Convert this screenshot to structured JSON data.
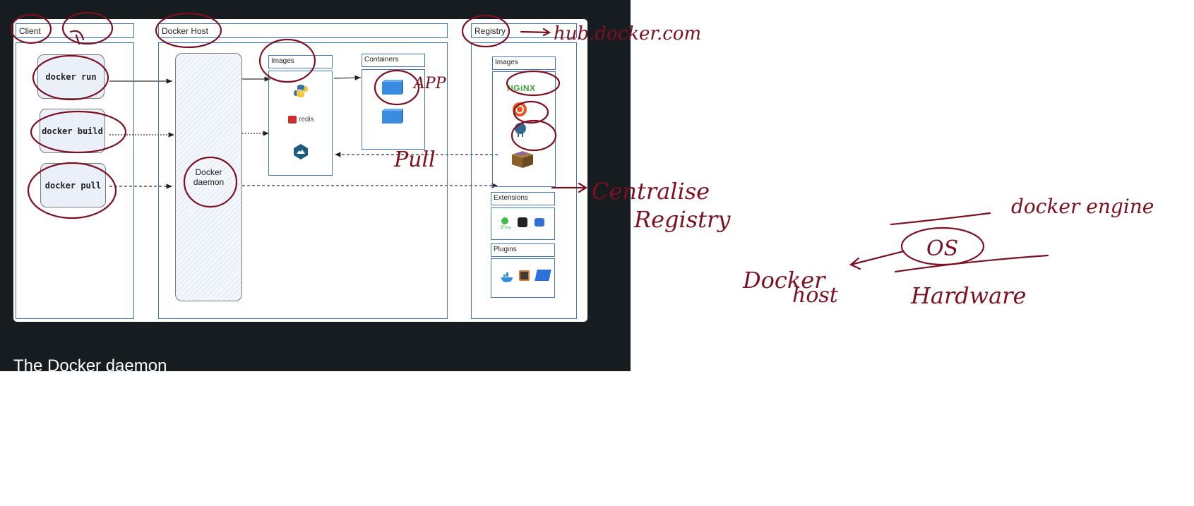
{
  "diagram": {
    "client": {
      "header": "Client",
      "commands": [
        "docker run",
        "docker build",
        "docker pull"
      ]
    },
    "docker_host": {
      "header": "Docker Host",
      "daemon_label": "Docker daemon",
      "images_header": "Images",
      "containers_header": "Containers",
      "images": [
        "python-icon",
        "redis",
        "alpine-icon"
      ],
      "redis_label": "redis"
    },
    "registry": {
      "header": "Registry",
      "images_header": "Images",
      "nginx_label": "NGiNX",
      "extensions_header": "Extensions",
      "extensions_text": "JFrog",
      "plugins_header": "Plugins"
    }
  },
  "page": {
    "section_heading": "The Docker daemon"
  },
  "annotations": {
    "hub_url": "hub.docker.com",
    "app": "APP",
    "pull": "Pull",
    "centralise_line1": "Centralise",
    "centralise_line2": "Registry",
    "docker_engine": "docker engine",
    "os": "OS",
    "docker_host_line1": "Docker",
    "docker_host_line2": "host",
    "hardware": "Hardware",
    "ink_color": "#7d1020"
  },
  "colors": {
    "accent_blue": "#3f78c0",
    "dark_bg": "#171c20",
    "container_blue": "#3b8be0"
  }
}
